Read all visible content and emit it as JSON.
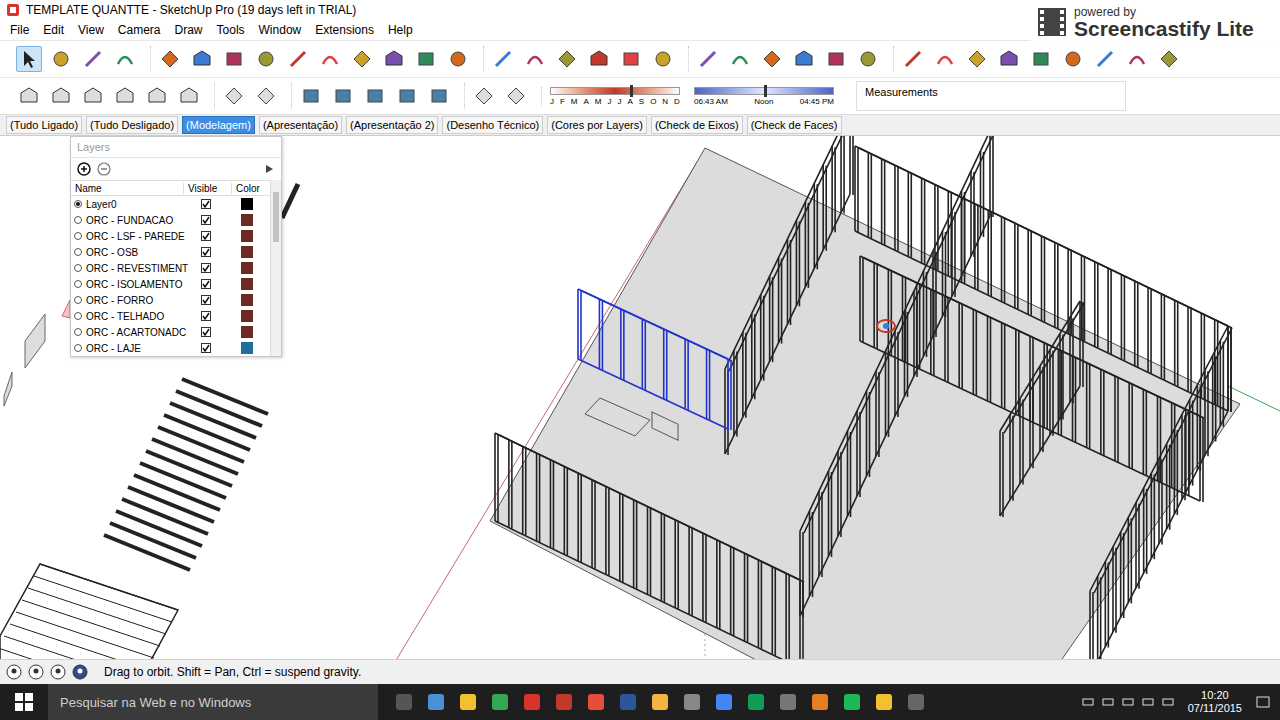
{
  "window": {
    "title": "TEMPLATE QUANTTE - SketchUp Pro (19 days left in TRIAL)"
  },
  "watermark": {
    "caption": "powered by",
    "brand": "Screencastify Lite"
  },
  "menu": [
    "File",
    "Edit",
    "View",
    "Camera",
    "Draw",
    "Tools",
    "Window",
    "Extensions",
    "Help"
  ],
  "select_tool": {
    "selected": true
  },
  "shadows": {
    "months": [
      "J",
      "F",
      "M",
      "A",
      "M",
      "J",
      "J",
      "A",
      "S",
      "O",
      "N",
      "D"
    ],
    "month_level": 0.62,
    "times": [
      "06:43 AM",
      "Noon",
      "04:45 PM"
    ],
    "time_level": 0.5
  },
  "measurements": {
    "label": "Measurements"
  },
  "scenes": [
    {
      "label": "(Tudo Ligado)",
      "selected": false
    },
    {
      "label": "(Tudo Desligado)",
      "selected": false
    },
    {
      "label": "(Modelagem)",
      "selected": true
    },
    {
      "label": "(Apresentação)",
      "selected": false
    },
    {
      "label": "(Apresentação 2)",
      "selected": false
    },
    {
      "label": "(Desenho Técnico)",
      "selected": false
    },
    {
      "label": "(Cores por Layers)",
      "selected": false
    },
    {
      "label": "(Check de Eixos)",
      "selected": false
    },
    {
      "label": "(Check de Faces)",
      "selected": false
    }
  ],
  "layers": {
    "title": "Layers",
    "columns": [
      "Name",
      "Visible",
      "Color"
    ],
    "rows": [
      {
        "name": "Layer0",
        "current": true,
        "visible": true,
        "color": "#000000"
      },
      {
        "name": "ORC - FUNDACAO",
        "current": false,
        "visible": true,
        "color": "#6b2a24"
      },
      {
        "name": "ORC - LSF - PAREDE",
        "current": false,
        "visible": true,
        "color": "#6b2a24"
      },
      {
        "name": "ORC - OSB",
        "current": false,
        "visible": true,
        "color": "#6b2a24"
      },
      {
        "name": "ORC - REVESTIMENT",
        "current": false,
        "visible": true,
        "color": "#6b2a24"
      },
      {
        "name": "ORC - ISOLAMENTO",
        "current": false,
        "visible": true,
        "color": "#6b2a24"
      },
      {
        "name": "ORC - FORRO",
        "current": false,
        "visible": true,
        "color": "#6b2a24"
      },
      {
        "name": "ORC - TELHADO",
        "current": false,
        "visible": true,
        "color": "#6b2a24"
      },
      {
        "name": "ORC - ACARTONADC",
        "current": false,
        "visible": true,
        "color": "#6b2a24"
      },
      {
        "name": "ORC - LAJE",
        "current": false,
        "visible": true,
        "color": "#1f6f99"
      }
    ]
  },
  "status_bar": {
    "text": "Drag to orbit. Shift = Pan, Ctrl = suspend gravity."
  },
  "taskbar": {
    "search": "Pesquisar na Web e no Windows",
    "time": "10:20",
    "date": "07/11/2015"
  }
}
